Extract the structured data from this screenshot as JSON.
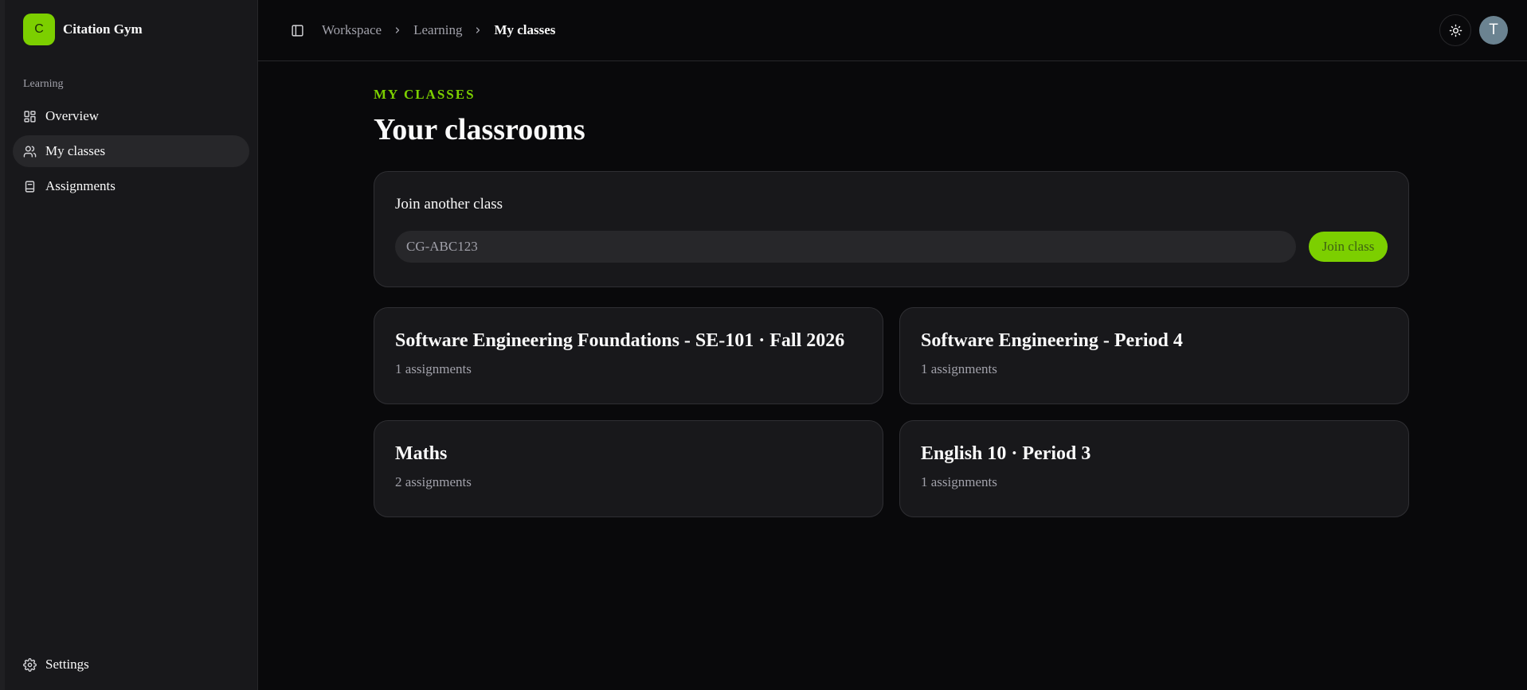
{
  "brand": {
    "logo_letter": "C",
    "name": "Citation Gym",
    "accent": "#7ccf00"
  },
  "sidebar": {
    "section_label": "Learning",
    "items": [
      {
        "label": "Overview",
        "icon": "layout-dashboard-icon",
        "active": false
      },
      {
        "label": "My classes",
        "icon": "users-icon",
        "active": true
      },
      {
        "label": "Assignments",
        "icon": "book-icon",
        "active": false
      }
    ],
    "settings_label": "Settings"
  },
  "topbar": {
    "breadcrumb": [
      "Workspace",
      "Learning",
      "My classes"
    ],
    "avatar_letter": "T"
  },
  "page": {
    "eyebrow": "MY CLASSES",
    "title": "Your classrooms"
  },
  "join": {
    "title": "Join another class",
    "placeholder": "CG-ABC123",
    "button_label": "Join class"
  },
  "classes": [
    {
      "name": "Software Engineering Foundations - SE-101 · Fall 2026",
      "meta": "1 assignments"
    },
    {
      "name": "Software Engineering - Period 4",
      "meta": "1 assignments"
    },
    {
      "name": "Maths",
      "meta": "2 assignments"
    },
    {
      "name": "English 10 · Period 3",
      "meta": "1 assignments"
    }
  ]
}
